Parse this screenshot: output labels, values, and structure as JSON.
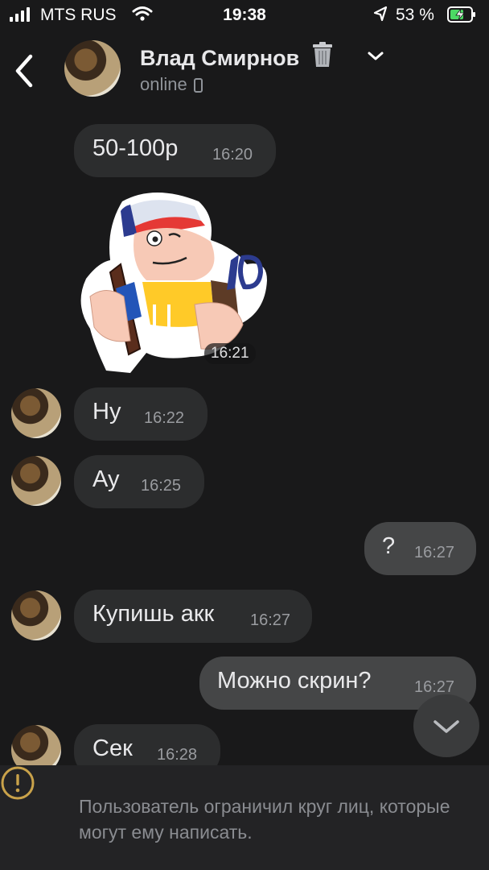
{
  "status_bar": {
    "carrier": "MTS RUS",
    "time": "19:38",
    "battery": "53 %"
  },
  "header": {
    "name": "Влад Смирнов",
    "status": "online"
  },
  "messages": [
    {
      "text": "50-100р",
      "time": "16:20"
    },
    {
      "sticker_time": "16:21"
    },
    {
      "text": "Ну",
      "time": "16:22"
    },
    {
      "text": "Ау",
      "time": "16:25"
    },
    {
      "text": "?",
      "time": "16:27"
    },
    {
      "text": "Купишь акк",
      "time": "16:27"
    },
    {
      "text": "Можно скрин?",
      "time": "16:27"
    },
    {
      "text": "Сек",
      "time": "16:28"
    }
  ],
  "notice": {
    "text": "Пользователь ограничил круг лиц, которые могут ему написать."
  },
  "colors": {
    "background": "#19191a",
    "incoming_bubble": "#2c2d2e",
    "outgoing_bubble": "#454647",
    "battery": "#4cd964"
  }
}
